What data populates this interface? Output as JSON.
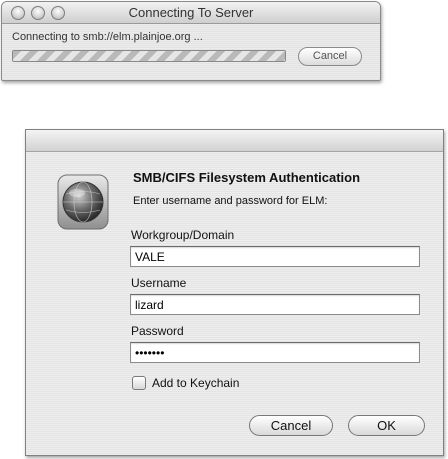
{
  "connecting_window": {
    "title": "Connecting To Server",
    "status_text": "Connecting to smb://elm.plainjoe.org ...",
    "progress": "indeterminate",
    "cancel_label": "Cancel"
  },
  "auth_dialog": {
    "icon": "network-globe-icon",
    "heading": "SMB/CIFS Filesystem Authentication",
    "subheading": "Enter username and password for ELM:",
    "fields": {
      "workgroup_label": "Workgroup/Domain",
      "workgroup_value": "VALE",
      "username_label": "Username",
      "username_value": "lizard",
      "password_label": "Password",
      "password_value": "•••••••"
    },
    "keychain_label": "Add to Keychain",
    "keychain_checked": false,
    "cancel_label": "Cancel",
    "ok_label": "OK"
  }
}
